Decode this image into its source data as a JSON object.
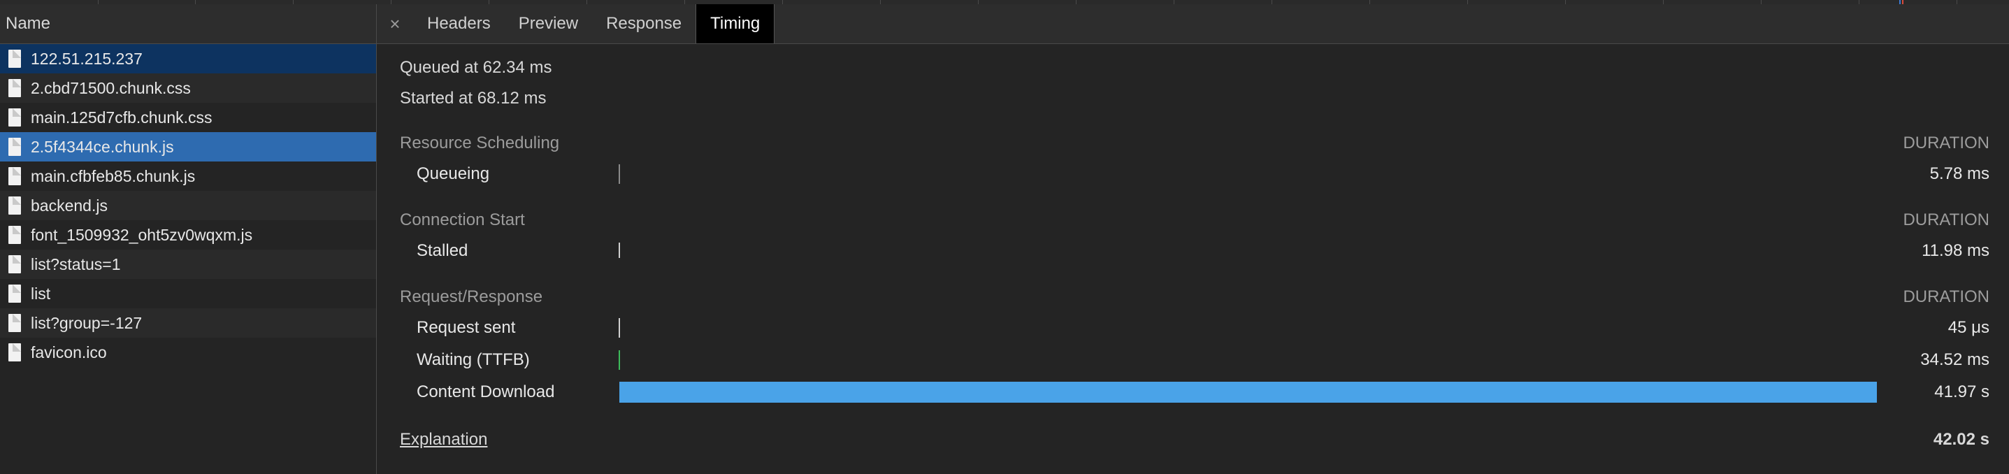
{
  "left_panel": {
    "header": "Name",
    "rows": [
      {
        "name": "122.51.215.237"
      },
      {
        "name": "2.cbd71500.chunk.css"
      },
      {
        "name": "main.125d7cfb.chunk.css"
      },
      {
        "name": "2.5f4344ce.chunk.js"
      },
      {
        "name": "main.cfbfeb85.chunk.js"
      },
      {
        "name": "backend.js"
      },
      {
        "name": "font_1509932_oht5zv0wqxm.js"
      },
      {
        "name": "list?status=1"
      },
      {
        "name": "list"
      },
      {
        "name": "list?group=-127"
      },
      {
        "name": "favicon.ico"
      }
    ]
  },
  "tabs": {
    "close_glyph": "×",
    "items": [
      "Headers",
      "Preview",
      "Response",
      "Timing"
    ],
    "active": "Timing"
  },
  "timing": {
    "queued": "Queued at 62.34 ms",
    "started": "Started at 68.12 ms",
    "sections": [
      {
        "title": "Resource Scheduling",
        "duration_label": "DURATION",
        "rows": [
          {
            "label": "Queueing",
            "value": "5.78 ms"
          }
        ]
      },
      {
        "title": "Connection Start",
        "duration_label": "DURATION",
        "rows": [
          {
            "label": "Stalled",
            "value": "11.98 ms"
          }
        ]
      },
      {
        "title": "Request/Response",
        "duration_label": "DURATION",
        "rows": [
          {
            "label": "Request sent",
            "value": "45 μs"
          },
          {
            "label": "Waiting (TTFB)",
            "value": "34.52 ms"
          },
          {
            "label": "Content Download",
            "value": "41.97 s"
          }
        ]
      }
    ],
    "explanation": "Explanation",
    "total": "42.02 s"
  },
  "colors": {
    "content_download_bar": "#4aa3e8",
    "ttfb_bar": "#3cba5a",
    "queueing_bar": "#8a8a8a",
    "selected_row": "#2e6bb0"
  }
}
